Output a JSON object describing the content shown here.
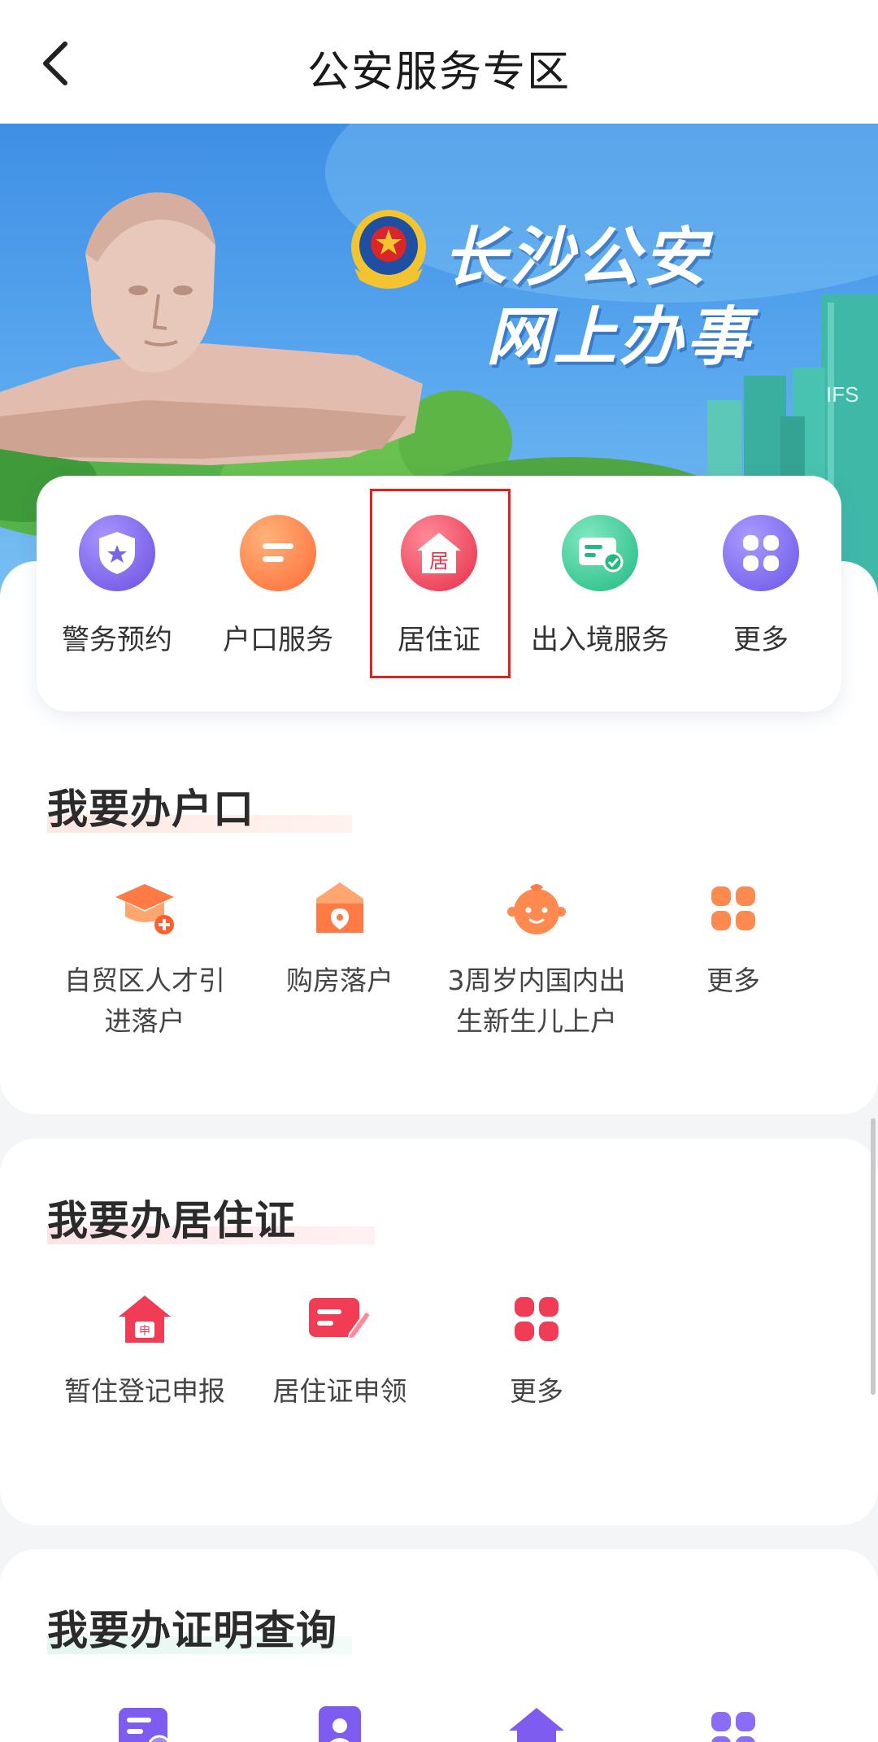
{
  "header": {
    "title": "公安服务专区",
    "back_icon": "chevron-left-icon"
  },
  "banner": {
    "line1": "长沙公安",
    "line2": "网上办事",
    "emblem_icon": "police-emblem-icon",
    "building_label": "IFS"
  },
  "quick_services": {
    "highlighted_index": 2,
    "items": [
      {
        "label": "警务预约",
        "icon": "shield-star-icon",
        "color": "#7b63e8"
      },
      {
        "label": "户口服务",
        "icon": "household-icon",
        "color": "#ff7a45"
      },
      {
        "label": "居住证",
        "icon": "house-residence-icon",
        "icon_text": "居",
        "color": "#ee3d55"
      },
      {
        "label": "出入境服务",
        "icon": "card-check-icon",
        "color": "#2fc38f"
      },
      {
        "label": "更多",
        "icon": "grid-more-icon",
        "color": "#7f6cf0"
      }
    ]
  },
  "sections": [
    {
      "title": "我要办户口",
      "items": [
        {
          "label": "自贸区人才引进落户",
          "icon": "graduation-cap-icon"
        },
        {
          "label": "购房落户",
          "icon": "house-location-icon"
        },
        {
          "label": "3周岁内国内出生新生儿上户",
          "icon": "baby-icon"
        },
        {
          "label": "更多",
          "icon": "grid-more-icon"
        }
      ]
    },
    {
      "title": "我要办居住证",
      "items": [
        {
          "label": "暂住登记申报",
          "icon": "house-apply-icon",
          "icon_text": "申"
        },
        {
          "label": "居住证申领",
          "icon": "card-edit-icon"
        },
        {
          "label": "更多",
          "icon": "grid-more-icon"
        }
      ]
    },
    {
      "title": "我要办证明查询",
      "items": [
        {
          "label": "",
          "icon": "document-badge-icon"
        },
        {
          "label": "",
          "icon": "profile-edit-icon"
        },
        {
          "label": "",
          "icon": "house-icon"
        },
        {
          "label": "",
          "icon": "grid-more-icon"
        }
      ]
    }
  ]
}
